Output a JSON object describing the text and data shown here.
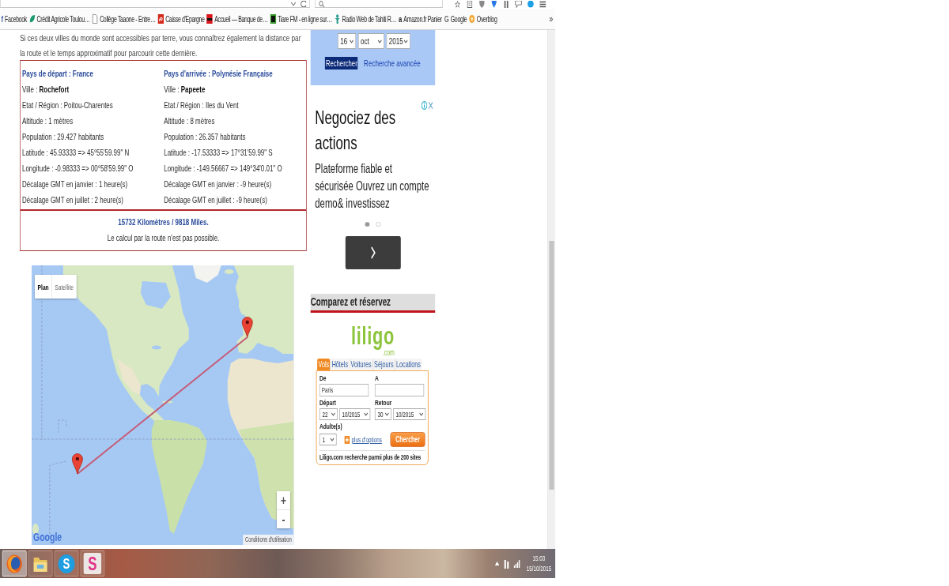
{
  "bookmarks_bar": {
    "items": [
      {
        "label": "Facebook",
        "kind": "glyph",
        "glyph": "f",
        "color": "#3b5998"
      },
      {
        "label": "Crédit Agricole Toulou…",
        "kind": "leaf"
      },
      {
        "label": "Collège Taaone - Entre…",
        "kind": "page"
      },
      {
        "label": "Caisse d'Epargne",
        "kind": "swirl"
      },
      {
        "label": "Accueil — Banque de…",
        "kind": "block"
      },
      {
        "label": "Tiare FM - en ligne sur…",
        "kind": "frame"
      },
      {
        "label": "Radio Web de Tahiti R…",
        "kind": "figure"
      },
      {
        "label": "Amazon.fr Panier",
        "kind": "glyph",
        "glyph": "a",
        "color": "#1a1a1a"
      },
      {
        "label": "Google",
        "kind": "glyph",
        "glyph": "G",
        "color": "#6b6b6b"
      },
      {
        "label": "Overblog",
        "kind": "circle"
      }
    ],
    "overflow": "»"
  },
  "page": {
    "intro": "Si ces deux villes du monde sont accessibles par terre, vous connaîtrez également la distance par\nla route et le temps approximatif pour parcourir cette dernière.",
    "route_box": {
      "departure": {
        "heading": "Pays de départ : France",
        "rows": [
          "Ville : **Rochefort**",
          "Etat / Région : Poitou-Charentes",
          "Altitude : 1 mètres",
          "Population : 29.427 habitants",
          "Latitude : 45.93333 => 45°55'59.99\" N",
          "Longitude : -0.98333 => 00°58'59.99\" O",
          "Décalage GMT en janvier : 1 heure(s)",
          "Décalage GMT en juillet : 2 heure(s)"
        ]
      },
      "arrival": {
        "heading": "Pays d'arrivée : Polynésie Française",
        "rows": [
          "Ville : **Papeete**",
          "Etat / Région : Iles du Vent",
          "Altitude : 8 mètres",
          "Population : 26.357 habitants",
          "Latitude : -17.53333 => 17°31'59.99\" S",
          "Longitude : -149.56667 => 149°34'0.01\" O",
          "Décalage GMT en janvier : -9 heure(s)",
          "Décalage GMT en juillet : -9 heure(s)"
        ]
      },
      "distance": "15732 Kilomètres / 9818 Miles.",
      "note": "Le calcul par la route n'est pas possible."
    },
    "map": {
      "view_buttons": [
        {
          "label": "Plan",
          "selected": true
        },
        {
          "label": "Satellite",
          "selected": false
        }
      ],
      "zoom_in": "+",
      "zoom_out": "-",
      "logo": "Google",
      "terms": "Conditions d'utilisation"
    }
  },
  "sidebar": {
    "date_search": {
      "day": "16",
      "month": "oct",
      "year": "2015",
      "search_button": "Rechercher",
      "advanced_link": "Recherche avancée"
    },
    "ad": {
      "title": "Negociez des\nactions",
      "body": "Plateforme fiable et\nsécurisée Ouvrez un compte\ndemo& investissez",
      "dots": [
        {
          "selected": true
        },
        {
          "selected": false
        }
      ]
    },
    "compare": {
      "title": "Comparez et réservez",
      "logo": "liligo",
      "logo_suffix": ".com",
      "tabs": [
        {
          "label": "Vols",
          "selected": true
        },
        {
          "label": "Hôtels",
          "selected": false
        },
        {
          "label": "Voitures",
          "selected": false
        },
        {
          "label": "Séjours",
          "selected": false
        },
        {
          "label": "Locations",
          "selected": false
        }
      ],
      "form": {
        "from_label": "De",
        "to_label": "A",
        "from_value": "Paris",
        "depart_label": "Départ",
        "return_label": "Retour",
        "depart_day": "22",
        "depart_month": "10/2015",
        "return_day": "30",
        "return_month": "10/2015",
        "adults_label": "Adulte(s)",
        "adults": "1",
        "options_link": "plus d'options",
        "submit": "Chercher",
        "footer": "Liligo.com recherche parmi plus de 200 sites"
      }
    }
  },
  "taskbar": {
    "apps": [
      {
        "kind": "browser",
        "selected": true
      },
      {
        "kind": "folder",
        "selected": false
      },
      {
        "kind": "badge",
        "glyph": "S",
        "color": "#1e9de0",
        "selected": false
      },
      {
        "kind": "letter",
        "glyph": "S",
        "color": "#e0338a",
        "selected": false
      }
    ],
    "time": "15:03",
    "date": "15/10/2015"
  }
}
